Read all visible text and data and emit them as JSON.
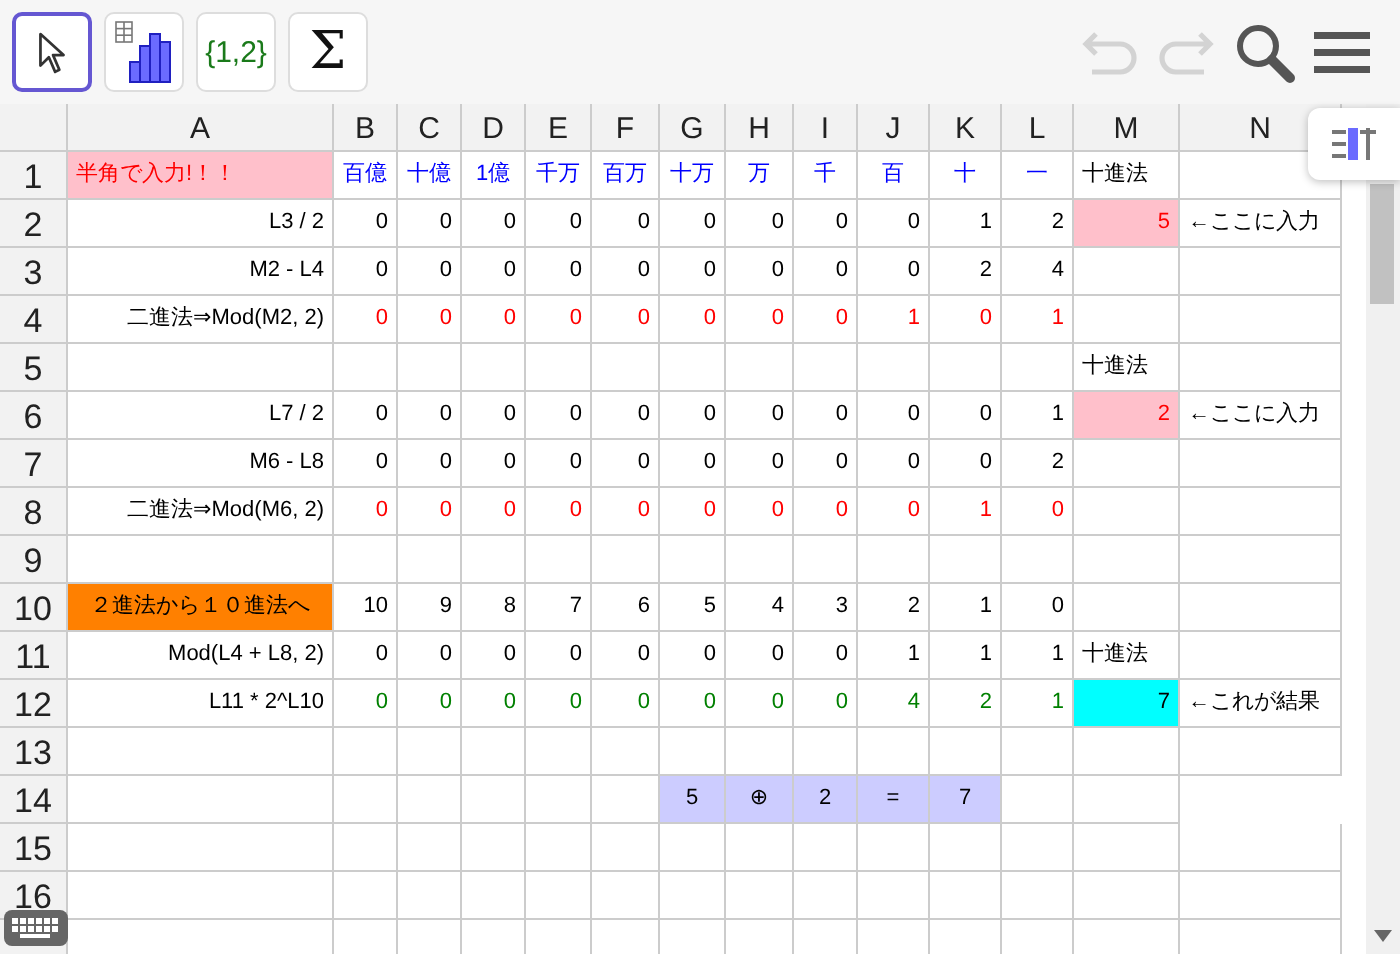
{
  "toolbar": {
    "tools": [
      {
        "kind": "pointer",
        "selected": true
      },
      {
        "kind": "chart",
        "selected": false
      },
      {
        "kind": "list",
        "label": "{1,2}",
        "selected": false
      },
      {
        "kind": "sum",
        "label": "Σ",
        "selected": false
      }
    ],
    "undo": {
      "disabled": true
    },
    "redo": {
      "disabled": true
    }
  },
  "columns": [
    "A",
    "B",
    "C",
    "D",
    "E",
    "F",
    "G",
    "H",
    "I",
    "J",
    "K",
    "L",
    "M",
    "N"
  ],
  "rows": [
    {
      "header": "1",
      "cells": [
        {
          "text": "半角で入力!！！",
          "kind": "warning",
          "color": "#ff0000"
        },
        {
          "text": "百億",
          "kind": "place",
          "color": "#0000ff"
        },
        {
          "text": "十億",
          "kind": "place",
          "color": "#0000ff"
        },
        {
          "text": "1億",
          "kind": "place",
          "color": "#0000ff"
        },
        {
          "text": "千万",
          "kind": "place",
          "color": "#0000ff"
        },
        {
          "text": "百万",
          "kind": "place",
          "color": "#0000ff"
        },
        {
          "text": "十万",
          "kind": "place",
          "color": "#0000ff"
        },
        {
          "text": "万",
          "kind": "place",
          "color": "#0000ff"
        },
        {
          "text": "千",
          "kind": "place",
          "color": "#0000ff"
        },
        {
          "text": "百",
          "kind": "place",
          "color": "#0000ff"
        },
        {
          "text": "十",
          "kind": "place",
          "color": "#0000ff"
        },
        {
          "text": "一",
          "kind": "place",
          "color": "#0000ff"
        },
        {
          "text": "十進法",
          "kind": "note"
        },
        null
      ]
    },
    {
      "header": "2",
      "cells": [
        {
          "text": "L3 / 2",
          "kind": "value"
        },
        {
          "text": "0",
          "kind": "value"
        },
        {
          "text": "0",
          "kind": "value"
        },
        {
          "text": "0",
          "kind": "value"
        },
        {
          "text": "0",
          "kind": "value"
        },
        {
          "text": "0",
          "kind": "value"
        },
        {
          "text": "0",
          "kind": "value"
        },
        {
          "text": "0",
          "kind": "value"
        },
        {
          "text": "0",
          "kind": "value"
        },
        {
          "text": "0",
          "kind": "value"
        },
        {
          "text": "1",
          "kind": "value"
        },
        {
          "text": "2",
          "kind": "value"
        },
        {
          "text": "5",
          "kind": "input",
          "color": "#ff0000"
        },
        {
          "text": "←ここに入力",
          "kind": "note"
        }
      ]
    },
    {
      "header": "3",
      "cells": [
        {
          "text": "M2 - L4",
          "kind": "value"
        },
        {
          "text": "0",
          "kind": "value"
        },
        {
          "text": "0",
          "kind": "value"
        },
        {
          "text": "0",
          "kind": "value"
        },
        {
          "text": "0",
          "kind": "value"
        },
        {
          "text": "0",
          "kind": "value"
        },
        {
          "text": "0",
          "kind": "value"
        },
        {
          "text": "0",
          "kind": "value"
        },
        {
          "text": "0",
          "kind": "value"
        },
        {
          "text": "0",
          "kind": "value"
        },
        {
          "text": "2",
          "kind": "value"
        },
        {
          "text": "4",
          "kind": "value"
        },
        null,
        null
      ]
    },
    {
      "header": "4",
      "cells": [
        {
          "text": "二進法⇒Mod(M2, 2)",
          "kind": "value"
        },
        {
          "text": "0",
          "kind": "value",
          "color": "#ff0000"
        },
        {
          "text": "0",
          "kind": "value",
          "color": "#ff0000"
        },
        {
          "text": "0",
          "kind": "value",
          "color": "#ff0000"
        },
        {
          "text": "0",
          "kind": "value",
          "color": "#ff0000"
        },
        {
          "text": "0",
          "kind": "value",
          "color": "#ff0000"
        },
        {
          "text": "0",
          "kind": "value",
          "color": "#ff0000"
        },
        {
          "text": "0",
          "kind": "value",
          "color": "#ff0000"
        },
        {
          "text": "0",
          "kind": "value",
          "color": "#ff0000"
        },
        {
          "text": "1",
          "kind": "value",
          "color": "#ff0000"
        },
        {
          "text": "0",
          "kind": "value",
          "color": "#ff0000"
        },
        {
          "text": "1",
          "kind": "value",
          "color": "#ff0000"
        },
        null,
        null
      ]
    },
    {
      "header": "5",
      "cells": [
        null,
        null,
        null,
        null,
        null,
        null,
        null,
        null,
        null,
        null,
        null,
        null,
        {
          "text": "十進法",
          "kind": "note"
        },
        null
      ]
    },
    {
      "header": "6",
      "cells": [
        {
          "text": "L7 / 2",
          "kind": "value"
        },
        {
          "text": "0",
          "kind": "value"
        },
        {
          "text": "0",
          "kind": "value"
        },
        {
          "text": "0",
          "kind": "value"
        },
        {
          "text": "0",
          "kind": "value"
        },
        {
          "text": "0",
          "kind": "value"
        },
        {
          "text": "0",
          "kind": "value"
        },
        {
          "text": "0",
          "kind": "value"
        },
        {
          "text": "0",
          "kind": "value"
        },
        {
          "text": "0",
          "kind": "value"
        },
        {
          "text": "0",
          "kind": "value"
        },
        {
          "text": "1",
          "kind": "value"
        },
        {
          "text": "2",
          "kind": "input",
          "color": "#ff0000"
        },
        {
          "text": "←ここに入力",
          "kind": "note"
        }
      ]
    },
    {
      "header": "7",
      "cells": [
        {
          "text": "M6 - L8",
          "kind": "value"
        },
        {
          "text": "0",
          "kind": "value"
        },
        {
          "text": "0",
          "kind": "value"
        },
        {
          "text": "0",
          "kind": "value"
        },
        {
          "text": "0",
          "kind": "value"
        },
        {
          "text": "0",
          "kind": "value"
        },
        {
          "text": "0",
          "kind": "value"
        },
        {
          "text": "0",
          "kind": "value"
        },
        {
          "text": "0",
          "kind": "value"
        },
        {
          "text": "0",
          "kind": "value"
        },
        {
          "text": "0",
          "kind": "value"
        },
        {
          "text": "2",
          "kind": "value"
        },
        null,
        null
      ]
    },
    {
      "header": "8",
      "cells": [
        {
          "text": "二進法⇒Mod(M6, 2)",
          "kind": "value"
        },
        {
          "text": "0",
          "kind": "value",
          "color": "#ff0000"
        },
        {
          "text": "0",
          "kind": "value",
          "color": "#ff0000"
        },
        {
          "text": "0",
          "kind": "value",
          "color": "#ff0000"
        },
        {
          "text": "0",
          "kind": "value",
          "color": "#ff0000"
        },
        {
          "text": "0",
          "kind": "value",
          "color": "#ff0000"
        },
        {
          "text": "0",
          "kind": "value",
          "color": "#ff0000"
        },
        {
          "text": "0",
          "kind": "value",
          "color": "#ff0000"
        },
        {
          "text": "0",
          "kind": "value",
          "color": "#ff0000"
        },
        {
          "text": "0",
          "kind": "value",
          "color": "#ff0000"
        },
        {
          "text": "1",
          "kind": "value",
          "color": "#ff0000"
        },
        {
          "text": "0",
          "kind": "value",
          "color": "#ff0000"
        },
        null,
        null
      ]
    },
    {
      "header": "9",
      "cells": [
        null,
        null,
        null,
        null,
        null,
        null,
        null,
        null,
        null,
        null,
        null,
        null,
        null,
        null
      ]
    },
    {
      "header": "10",
      "cells": [
        {
          "text": "２進法から１０進法へ",
          "kind": "banner"
        },
        {
          "text": "10",
          "kind": "value"
        },
        {
          "text": "9",
          "kind": "value"
        },
        {
          "text": "8",
          "kind": "value"
        },
        {
          "text": "7",
          "kind": "value"
        },
        {
          "text": "6",
          "kind": "value"
        },
        {
          "text": "5",
          "kind": "value"
        },
        {
          "text": "4",
          "kind": "value"
        },
        {
          "text": "3",
          "kind": "value"
        },
        {
          "text": "2",
          "kind": "value"
        },
        {
          "text": "1",
          "kind": "value"
        },
        {
          "text": "0",
          "kind": "value"
        },
        null,
        null
      ]
    },
    {
      "header": "11",
      "cells": [
        {
          "text": "Mod(L4 + L8, 2)",
          "kind": "value"
        },
        {
          "text": "0",
          "kind": "value"
        },
        {
          "text": "0",
          "kind": "value"
        },
        {
          "text": "0",
          "kind": "value"
        },
        {
          "text": "0",
          "kind": "value"
        },
        {
          "text": "0",
          "kind": "value"
        },
        {
          "text": "0",
          "kind": "value"
        },
        {
          "text": "0",
          "kind": "value"
        },
        {
          "text": "0",
          "kind": "value"
        },
        {
          "text": "1",
          "kind": "value"
        },
        {
          "text": "1",
          "kind": "value"
        },
        {
          "text": "1",
          "kind": "value"
        },
        {
          "text": "十進法",
          "kind": "note"
        },
        null
      ]
    },
    {
      "header": "12",
      "cells": [
        {
          "text": "L11 * 2^L10",
          "kind": "value"
        },
        {
          "text": "0",
          "kind": "value",
          "color": "#008000"
        },
        {
          "text": "0",
          "kind": "value",
          "color": "#008000"
        },
        {
          "text": "0",
          "kind": "value",
          "color": "#008000"
        },
        {
          "text": "0",
          "kind": "value",
          "color": "#008000"
        },
        {
          "text": "0",
          "kind": "value",
          "color": "#008000"
        },
        {
          "text": "0",
          "kind": "value",
          "color": "#008000"
        },
        {
          "text": "0",
          "kind": "value",
          "color": "#008000"
        },
        {
          "text": "0",
          "kind": "value",
          "color": "#008000"
        },
        {
          "text": "4",
          "kind": "value",
          "color": "#008000"
        },
        {
          "text": "2",
          "kind": "value",
          "color": "#008000"
        },
        {
          "text": "1",
          "kind": "value",
          "color": "#008000"
        },
        {
          "text": "7",
          "kind": "result"
        },
        {
          "text": "←これが結果",
          "kind": "note"
        }
      ]
    },
    {
      "header": "13",
      "cells": [
        null,
        null,
        null,
        null,
        null,
        null,
        null,
        null,
        null,
        null,
        null,
        null,
        null,
        null
      ]
    },
    {
      "header": "14",
      "cells": [
        null,
        null,
        null,
        null,
        null,
        null,
        {
          "text": "5",
          "kind": "equation"
        },
        {
          "text": "⊕",
          "kind": "equation"
        },
        {
          "text": "2",
          "kind": "equation"
        },
        {
          "text": "=",
          "kind": "equation"
        },
        {
          "text": "7",
          "kind": "equation"
        },
        null,
        null
      ]
    },
    {
      "header": "15",
      "cells": [
        null,
        null,
        null,
        null,
        null,
        null,
        null,
        null,
        null,
        null,
        null,
        null,
        null,
        null
      ]
    },
    {
      "header": "16",
      "cells": [
        null,
        null,
        null,
        null,
        null,
        null,
        null,
        null,
        null,
        null,
        null,
        null,
        null,
        null
      ]
    },
    {
      "cells": [
        null,
        null,
        null,
        null,
        null,
        null,
        null,
        null,
        null,
        null,
        null,
        null,
        null,
        null
      ]
    }
  ]
}
